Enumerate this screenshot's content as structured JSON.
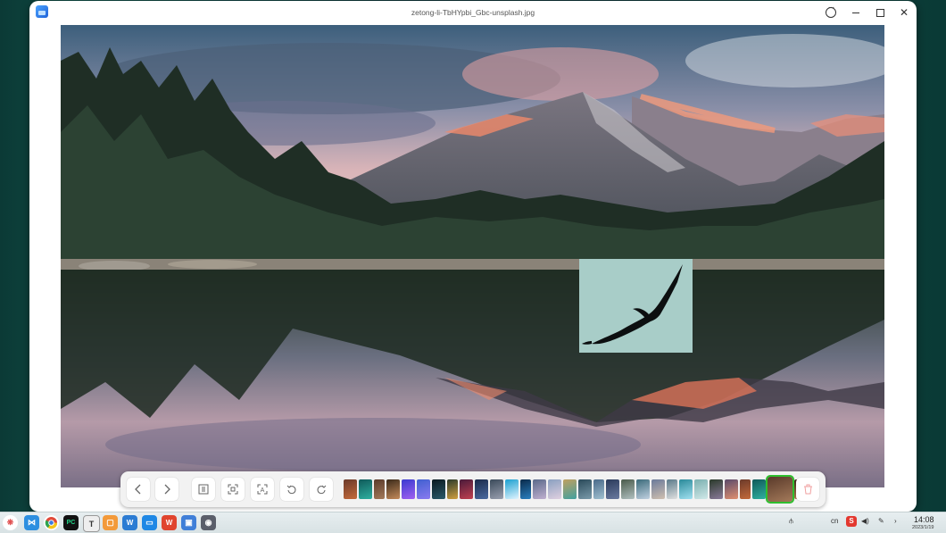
{
  "window": {
    "title": "zetong-li-TbHYpbi_Gbc-unsplash.jpg",
    "icons": {
      "app": "image-viewer-icon",
      "more": "more-options-icon",
      "minimize": "minimize-icon",
      "maximize": "maximize-icon",
      "close": "close-icon"
    }
  },
  "viewer": {
    "image_description_icon": "mountain-lake-photo",
    "overlay_icon": "eagle-silhouette-icon"
  },
  "toolbar": {
    "buttons": [
      "previous-icon",
      "next-icon",
      "original-size-icon",
      "fit-window-icon",
      "ocr-icon",
      "rotate-left-icon",
      "rotate-right-icon",
      "delete-icon"
    ],
    "thumbnail_count": 31,
    "active_thumbnail_index": 29,
    "colors": {
      "active_outline": "#2fbf2f"
    }
  },
  "taskbar": {
    "apps": [
      "launcher-icon",
      "vscode-icon",
      "chrome-icon",
      "pycharm-icon",
      "typora-icon",
      "chat-icon",
      "wps-writer-icon",
      "app-store-icon",
      "wps-presentation-icon",
      "image-viewer-icon",
      "camera-icon"
    ],
    "tray": {
      "input_method": "cn",
      "time": "14:08",
      "date": "2023/1/19"
    }
  }
}
